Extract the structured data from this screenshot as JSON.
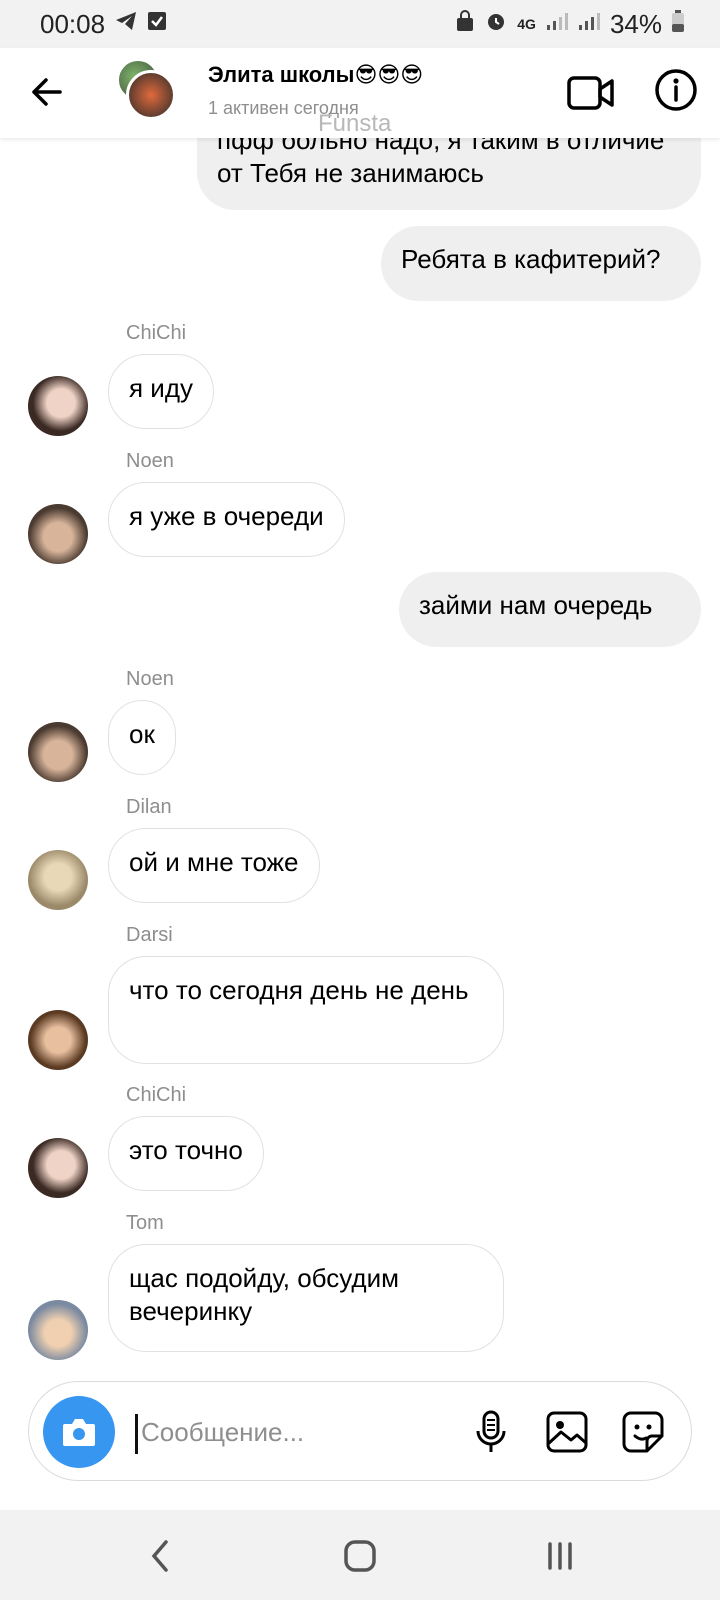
{
  "status_bar": {
    "time": "00:08",
    "signal_tech": "4G",
    "battery": "34%"
  },
  "header": {
    "title": "Элита школы😎😎😎",
    "subtitle": "1 активен сегодня",
    "watermark": "Funsta"
  },
  "messages": [
    {
      "type": "out",
      "text": "пфф больно надо, я таким в отличие от Тебя не занимаюсь"
    },
    {
      "type": "out",
      "text": "Ребята в кафитерий?"
    },
    {
      "type": "in",
      "sender": "ChiChi",
      "avatar": "chichi",
      "text": "я иду"
    },
    {
      "type": "in",
      "sender": "Noen",
      "avatar": "noen",
      "text": "я уже в очереди"
    },
    {
      "type": "out",
      "text": "займи нам очередь"
    },
    {
      "type": "in",
      "sender": "Noen",
      "avatar": "noen",
      "text": "ок"
    },
    {
      "type": "in",
      "sender": "Dilan",
      "avatar": "dilan",
      "text": "ой и мне тоже"
    },
    {
      "type": "in",
      "sender": "Darsi",
      "avatar": "darsi",
      "text": "что то сегодня день не день"
    },
    {
      "type": "in",
      "sender": "ChiChi",
      "avatar": "chichi",
      "text": "это точно"
    },
    {
      "type": "in",
      "sender": "Tom",
      "avatar": "tom",
      "text": "щас подойду, обсудим вечеринку"
    }
  ],
  "composer": {
    "placeholder": "Сообщение..."
  },
  "colors": {
    "accent": "#3797f0",
    "outgoing_bubble": "#efefef",
    "incoming_border": "#e1e1e1",
    "secondary_text": "#8e8e8e"
  },
  "icons": [
    "back-arrow-icon",
    "video-camera-icon",
    "info-icon",
    "camera-icon",
    "microphone-icon",
    "gallery-icon",
    "sticker-icon"
  ]
}
